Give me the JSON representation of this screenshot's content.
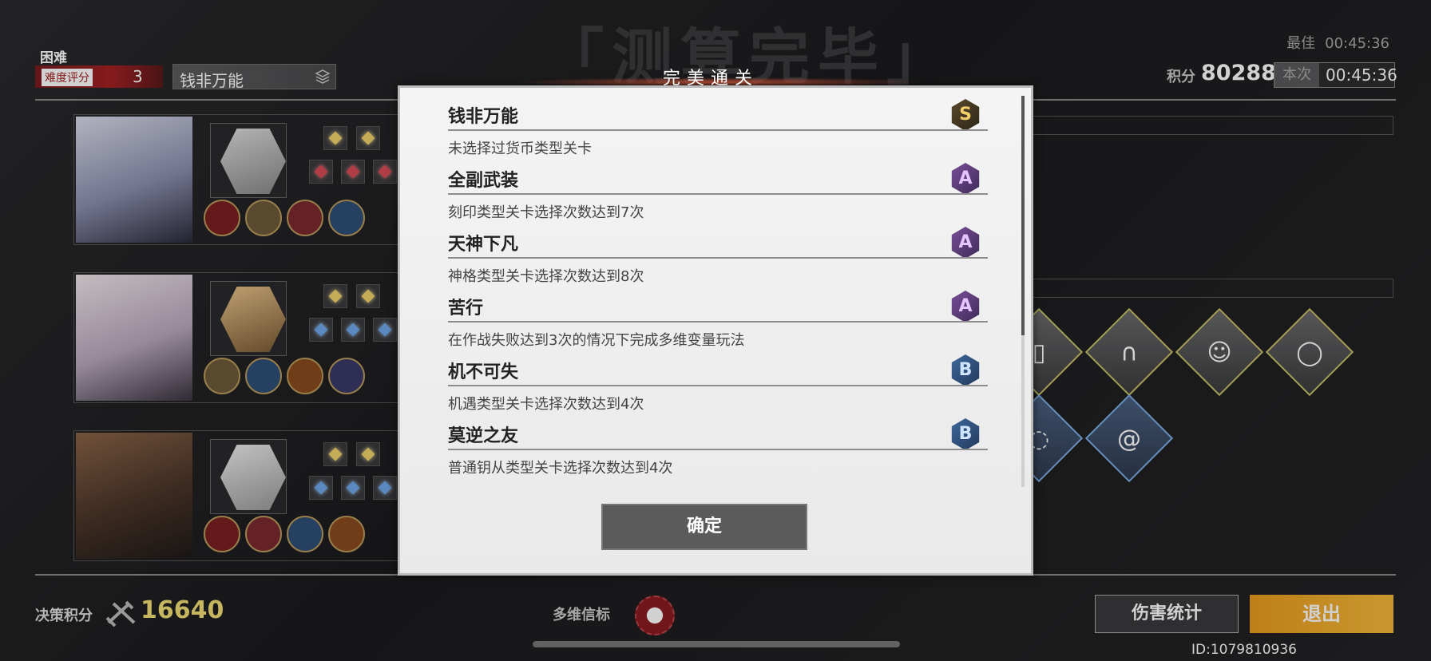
{
  "background_title": "「测算完毕」",
  "header": {
    "difficulty": "困难",
    "difficulty_label": "难度评分",
    "difficulty_score": "3",
    "stage_name": "钱非万能",
    "best_label": "最佳",
    "best_time": "00:45:36",
    "score_label": "积分",
    "score_value": "80288",
    "this_label": "本次",
    "this_time": "00:45:36"
  },
  "modal": {
    "title": "完美通关",
    "achievements": [
      {
        "name": "钱非万能",
        "desc": "未选择过货币类型关卡",
        "grade": "S"
      },
      {
        "name": "全副武装",
        "desc": "刻印类型关卡选择次数达到7次",
        "grade": "A"
      },
      {
        "name": "天神下凡",
        "desc": "神格类型关卡选择次数达到8次",
        "grade": "A"
      },
      {
        "name": "苦行",
        "desc": "在作战失败达到3次的情况下完成多维变量玩法",
        "grade": "A"
      },
      {
        "name": "机不可失",
        "desc": "机遇类型关卡选择次数达到4次",
        "grade": "B"
      },
      {
        "name": "莫逆之友",
        "desc": "普通钥从类型关卡选择次数达到4次",
        "grade": "B"
      }
    ],
    "confirm_label": "确定"
  },
  "footer": {
    "decision_label": "决策积分",
    "decision_value": "16640",
    "beacon_label": "多维信标",
    "damage_button": "伤害统计",
    "exit_button": "退出",
    "uid": "ID:1079810936"
  },
  "colors": {
    "accent_red": "#a32124",
    "exit_orange": "#f5b93a",
    "score_yellow": "#f1df74"
  },
  "icons": {
    "stage_select": "layers-icon",
    "decision": "crossed-tools-icon",
    "beacon": "beacon-emblem-icon"
  }
}
